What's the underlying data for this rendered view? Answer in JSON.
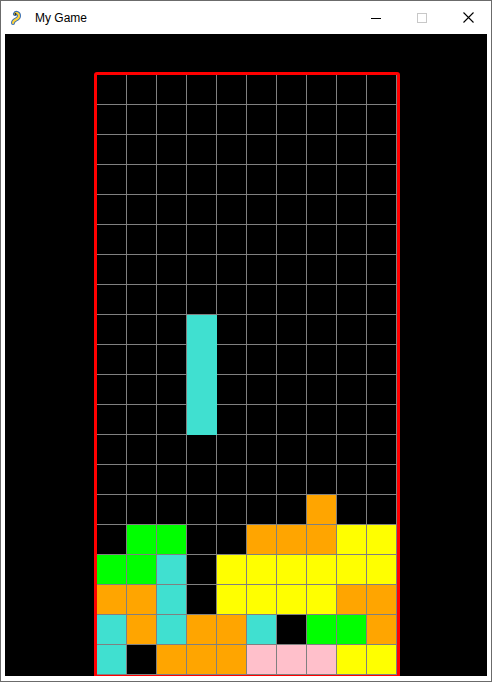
{
  "window": {
    "title": "My Game"
  },
  "board": {
    "columns": 10,
    "rows": [
      [
        null,
        null,
        null,
        null,
        null,
        null,
        null,
        null,
        null,
        null
      ],
      [
        null,
        null,
        null,
        null,
        null,
        null,
        null,
        null,
        null,
        null
      ],
      [
        null,
        null,
        null,
        null,
        null,
        null,
        null,
        null,
        null,
        null
      ],
      [
        null,
        null,
        null,
        null,
        null,
        null,
        null,
        null,
        null,
        null
      ],
      [
        null,
        null,
        null,
        null,
        null,
        null,
        null,
        null,
        null,
        null
      ],
      [
        null,
        null,
        null,
        null,
        null,
        null,
        null,
        null,
        null,
        null
      ],
      [
        null,
        null,
        null,
        null,
        null,
        null,
        null,
        null,
        null,
        null
      ],
      [
        null,
        null,
        null,
        null,
        null,
        null,
        null,
        null,
        null,
        null
      ],
      [
        null,
        null,
        null,
        null,
        null,
        null,
        null,
        null,
        null,
        null
      ],
      [
        null,
        null,
        null,
        null,
        null,
        null,
        null,
        null,
        null,
        null
      ],
      [
        null,
        null,
        null,
        null,
        null,
        null,
        null,
        null,
        null,
        null
      ],
      [
        null,
        null,
        null,
        null,
        null,
        null,
        null,
        null,
        null,
        null
      ],
      [
        null,
        null,
        null,
        null,
        null,
        null,
        null,
        null,
        null,
        null
      ],
      [
        null,
        null,
        null,
        null,
        null,
        null,
        null,
        null,
        null,
        null
      ],
      [
        null,
        null,
        null,
        null,
        null,
        null,
        null,
        "#ffa500",
        null,
        null
      ],
      [
        null,
        "#00ff00",
        "#00ff00",
        null,
        null,
        "#ffa500",
        "#ffa500",
        "#ffa500",
        "#ffff00",
        "#ffff00"
      ],
      [
        "#00ff00",
        "#00ff00",
        "#40e0d0",
        null,
        "#ffff00",
        "#ffff00",
        "#ffff00",
        "#ffff00",
        "#ffff00",
        "#ffff00"
      ],
      [
        "#ffa500",
        "#ffa500",
        "#40e0d0",
        null,
        "#ffff00",
        "#ffff00",
        "#ffff00",
        "#ffff00",
        "#ffa500",
        "#ffa500"
      ],
      [
        "#40e0d0",
        "#ffa500",
        "#40e0d0",
        "#ffa500",
        "#ffa500",
        "#40e0d0",
        null,
        "#00ff00",
        "#00ff00",
        "#ffa500"
      ],
      [
        "#40e0d0",
        null,
        "#ffa500",
        "#ffa500",
        "#ffa500",
        "#ffc0cb",
        "#ffc0cb",
        "#ffc0cb",
        "#ffff00",
        "#ffff00"
      ]
    ]
  },
  "active_piece": {
    "color": "#40e0d0",
    "cells": [
      [
        8,
        3
      ],
      [
        9,
        3
      ],
      [
        10,
        3
      ],
      [
        11,
        3
      ]
    ]
  }
}
